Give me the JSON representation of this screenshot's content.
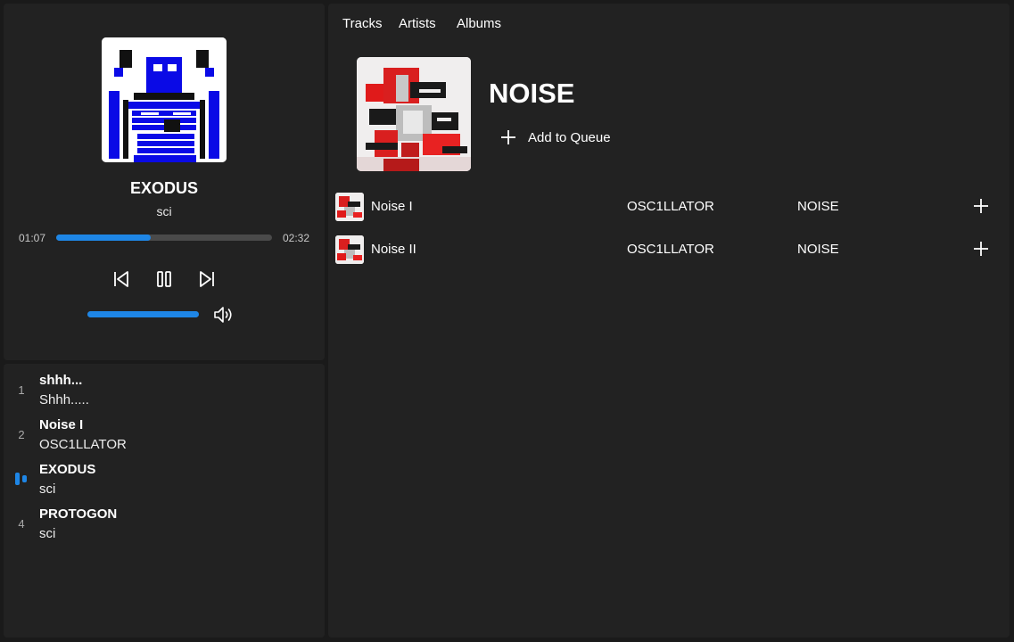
{
  "colors": {
    "accent": "#1e86e6",
    "panel": "#222222",
    "background": "#1a1a1a"
  },
  "now_playing": {
    "title": "EXODUS",
    "artist": "sci",
    "elapsed": "01:07",
    "duration": "02:32",
    "progress_fraction": 0.44,
    "volume_fraction": 1.0,
    "controls": {
      "previous_icon": "skip-previous-icon",
      "pause_icon": "pause-icon",
      "next_icon": "skip-next-icon",
      "volume_icon": "volume-icon"
    }
  },
  "queue": [
    {
      "number": "1",
      "title": "shhh...",
      "artist": "Shhh.....",
      "playing": false
    },
    {
      "number": "2",
      "title": "Noise I",
      "artist": "OSC1LLATOR",
      "playing": false
    },
    {
      "number": "",
      "title": "EXODUS",
      "artist": "sci",
      "playing": true
    },
    {
      "number": "4",
      "title": "PROTOGON",
      "artist": "sci",
      "playing": false
    }
  ],
  "nav": {
    "tabs": [
      "Tracks",
      "Artists",
      "Albums"
    ]
  },
  "album": {
    "title": "NOISE",
    "add_to_queue_label": "Add to Queue",
    "tracks": [
      {
        "name": "Noise I",
        "artist": "OSC1LLATOR",
        "album": "NOISE"
      },
      {
        "name": "Noise II",
        "artist": "OSC1LLATOR",
        "album": "NOISE"
      }
    ]
  }
}
